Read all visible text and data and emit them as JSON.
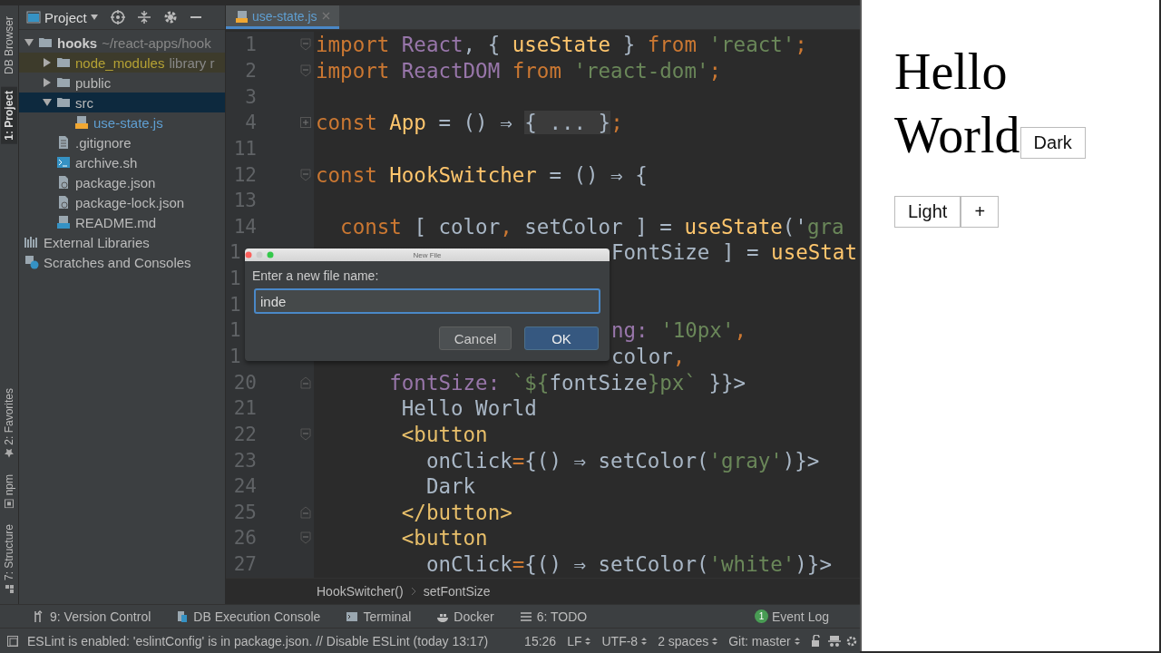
{
  "side_tabs_top": [
    {
      "label": "DB Browser",
      "selected": false
    },
    {
      "label": "1: Project",
      "selected": true
    }
  ],
  "side_tabs_bottom": [
    {
      "label": "2: Favorites",
      "kind": "star"
    },
    {
      "label": "npm",
      "kind": "npm"
    },
    {
      "label": "7: Structure",
      "kind": "structure"
    }
  ],
  "project": {
    "title": "Project",
    "tree": [
      {
        "label": "hooks",
        "note": "~/react-apps/hook",
        "kind": "folder",
        "expanded": true,
        "selected": false,
        "children": [
          {
            "label": "node_modules",
            "note": "library r",
            "kind": "excluded",
            "expanded": false,
            "selected": false
          },
          {
            "label": "public",
            "kind": "folder",
            "expanded": false,
            "selected": false
          },
          {
            "label": "src",
            "kind": "folder",
            "expanded": true,
            "selected": true,
            "children": [
              {
                "label": "use-state.js",
                "kind": "js",
                "selected": false
              }
            ]
          },
          {
            "label": ".gitignore",
            "kind": "text",
            "selected": false
          },
          {
            "label": "archive.sh",
            "kind": "shell",
            "selected": false
          },
          {
            "label": "package.json",
            "kind": "json",
            "selected": false
          },
          {
            "label": "package-lock.json",
            "kind": "json",
            "selected": false
          },
          {
            "label": "README.md",
            "kind": "md",
            "selected": false
          }
        ]
      },
      {
        "label": "External Libraries",
        "kind": "library",
        "selected": false
      },
      {
        "label": "Scratches and Consoles",
        "kind": "scratch",
        "selected": false
      }
    ]
  },
  "editor": {
    "tab": {
      "label": "use-state.js",
      "selected": true
    },
    "lines": [
      {
        "number": "1",
        "kind": "fold-start",
        "tokens": [
          {
            "text": "import ",
            "kind": "keyword"
          },
          {
            "text": "React",
            "kind": "class"
          },
          {
            "text": ", { ",
            "kind": "plain"
          },
          {
            "text": "useState",
            "kind": "function"
          },
          {
            "text": " } ",
            "kind": "plain"
          },
          {
            "text": "from ",
            "kind": "keyword"
          },
          {
            "text": "'react'",
            "kind": "string"
          },
          {
            "text": ";",
            "kind": "keyword"
          }
        ]
      },
      {
        "number": "2",
        "kind": "fold-start",
        "tokens": [
          {
            "text": "import ",
            "kind": "keyword"
          },
          {
            "text": "ReactDOM ",
            "kind": "class"
          },
          {
            "text": "from ",
            "kind": "keyword"
          },
          {
            "text": "'react-dom'",
            "kind": "string"
          },
          {
            "text": ";",
            "kind": "keyword"
          }
        ]
      },
      {
        "number": "3",
        "kind": "plain"
      },
      {
        "number": "4",
        "kind": "folded",
        "tokens": [
          {
            "text": "const ",
            "kind": "keyword"
          },
          {
            "text": "App",
            "kind": "function"
          },
          {
            "text": " = () ⇒ ",
            "kind": "plain"
          },
          {
            "text": "{ ... }",
            "kind": "folded"
          },
          {
            "text": ";",
            "kind": "keyword"
          }
        ]
      },
      {
        "number": "11",
        "kind": "plain"
      },
      {
        "number": "12",
        "kind": "fold-start",
        "tokens": [
          {
            "text": "const ",
            "kind": "keyword"
          },
          {
            "text": "HookSwitcher",
            "kind": "function"
          },
          {
            "text": " = () ⇒ {",
            "kind": "plain"
          }
        ]
      },
      {
        "number": "13",
        "kind": "plain"
      },
      {
        "number": "14",
        "kind": "plain",
        "tokens": [
          {
            "text": "  const ",
            "kind": "keyword"
          },
          {
            "text": "[ color",
            "kind": "plain"
          },
          {
            "text": ", ",
            "kind": "keyword"
          },
          {
            "text": "setColor ] = ",
            "kind": "plain"
          },
          {
            "text": "useState",
            "kind": "function"
          },
          {
            "text": "('",
            "kind": "plain"
          },
          {
            "text": "gra",
            "kind": "string"
          }
        ]
      },
      {
        "number": "1",
        "kind": "clipped",
        "tokens": [
          {
            "text": "FontSize ] = ",
            "kind": "plain"
          },
          {
            "text": "useStat",
            "kind": "function"
          }
        ]
      },
      {
        "number": "1",
        "kind": "clipped"
      },
      {
        "number": "1",
        "kind": "clipped"
      },
      {
        "number": "1",
        "kind": "clipped",
        "tokens": [
          {
            "text": "ng: ",
            "kind": "property"
          },
          {
            "text": "'10px'",
            "kind": "string"
          },
          {
            "text": ",",
            "kind": "keyword"
          }
        ]
      },
      {
        "number": "1",
        "kind": "clipped",
        "tokens": [
          {
            "text": "color",
            "kind": "plain"
          },
          {
            "text": ",",
            "kind": "keyword"
          }
        ]
      },
      {
        "number": "20",
        "kind": "fold-end",
        "tokens": [
          {
            "text": "      fontSize: ",
            "kind": "property"
          },
          {
            "text": "`${",
            "kind": "string"
          },
          {
            "text": "fontSize",
            "kind": "plain"
          },
          {
            "text": "}px`",
            "kind": "string"
          },
          {
            "text": " }}>",
            "kind": "plain"
          }
        ]
      },
      {
        "number": "21",
        "kind": "plain",
        "tokens": [
          {
            "text": "       Hello World",
            "kind": "plain"
          }
        ]
      },
      {
        "number": "22",
        "kind": "fold-start",
        "tokens": [
          {
            "text": "       <button",
            "kind": "tag"
          }
        ]
      },
      {
        "number": "23",
        "kind": "plain",
        "tokens": [
          {
            "text": "         onClick",
            "kind": "plain"
          },
          {
            "text": "=",
            "kind": "keyword"
          },
          {
            "text": "{() ⇒ setColor(",
            "kind": "plain"
          },
          {
            "text": "'gray'",
            "kind": "string"
          },
          {
            "text": ")}>",
            "kind": "plain"
          }
        ]
      },
      {
        "number": "24",
        "kind": "plain",
        "tokens": [
          {
            "text": "         Dark",
            "kind": "plain"
          }
        ]
      },
      {
        "number": "25",
        "kind": "fold-end",
        "tokens": [
          {
            "text": "       </button>",
            "kind": "tag"
          }
        ]
      },
      {
        "number": "26",
        "kind": "fold-start",
        "tokens": [
          {
            "text": "       <button",
            "kind": "tag"
          }
        ]
      },
      {
        "number": "27",
        "kind": "plain",
        "tokens": [
          {
            "text": "         onClick",
            "kind": "plain"
          },
          {
            "text": "=",
            "kind": "keyword"
          },
          {
            "text": "{() ⇒ setColor(",
            "kind": "plain"
          },
          {
            "text": "'white'",
            "kind": "string"
          },
          {
            "text": ")}>",
            "kind": "plain"
          }
        ]
      }
    ],
    "breadcrumbs": [
      "HookSwitcher()",
      "setFontSize"
    ]
  },
  "dialog": {
    "title": "New File",
    "prompt": "Enter a new file name:",
    "value": "inde",
    "buttons": [
      {
        "label": "Cancel",
        "primary": false
      },
      {
        "label": "OK",
        "primary": true
      }
    ]
  },
  "tool_windows": [
    {
      "label": "9: Version Control",
      "kind": "vcs"
    },
    {
      "label": "DB Execution Console",
      "kind": "db"
    },
    {
      "label": "Terminal",
      "kind": "terminal"
    },
    {
      "label": "Docker",
      "kind": "docker"
    },
    {
      "label": "6: TODO",
      "kind": "todo"
    }
  ],
  "event_log": {
    "label": "Event Log",
    "count": "1"
  },
  "status": {
    "message": "ESLint is enabled: 'eslintConfig' is in package.json. // Disable ESLint (today 13:17)",
    "position": "15:26",
    "items": [
      "LF",
      "UTF-8",
      "2 spaces",
      "Git: master"
    ]
  },
  "preview": {
    "heading": "Hello World",
    "buttons": [
      {
        "label": "Dark",
        "kind": "inline"
      },
      {
        "label": "Light",
        "kind": "below"
      },
      {
        "label": "+",
        "kind": "below"
      }
    ]
  }
}
